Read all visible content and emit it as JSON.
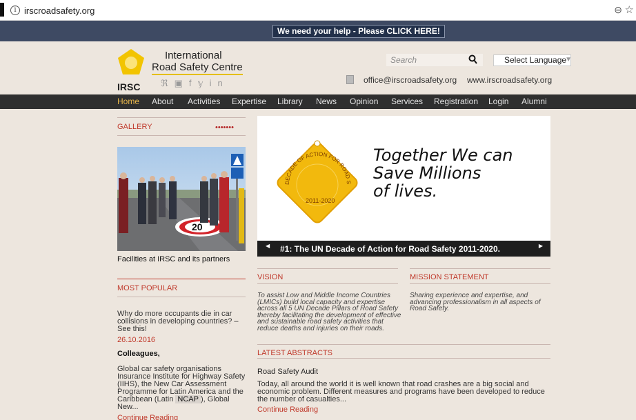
{
  "browser": {
    "url": "irscroadsafety.org",
    "info_glyph": "i",
    "zoom_glyph": "⊖",
    "star_glyph": "☆"
  },
  "help_banner": {
    "label": "We need your help - Please CLICK HERE!"
  },
  "header": {
    "logo_line1": "International",
    "logo_line2": "Road Safety Centre",
    "logo_abbr": "IRSC",
    "social_icons": [
      "rss-icon",
      "youtube-icon",
      "facebook-icon",
      "twitter-icon",
      "linkedin-icon"
    ],
    "social_glyphs": "ℜ▣f𝕪in",
    "search_placeholder": "Search",
    "language_select": "Select Language",
    "email": "office@irscroadsafety.org",
    "website": "www.irscroadsafety.org",
    "accent_color": "#e4bf00"
  },
  "nav": {
    "items": [
      "Home",
      "About",
      "Activities",
      "Expertise",
      "Library",
      "News",
      "Opinion",
      "Services",
      "Registration",
      "Login",
      "Alumni"
    ],
    "active": "Home"
  },
  "gallery": {
    "title": "GALLERY",
    "dots": "•••••••",
    "caption": "Facilities at IRSC and its partners",
    "sign_number": "20"
  },
  "most_popular": {
    "title": "MOST POPULAR",
    "question": "Why do more occupants die in car collisions in developing countries? – See this!",
    "date": "26.10.2016",
    "heading": "Colleagues,",
    "body_before": "Global car safety organisations Insurance Institute for Highway Safety (IIHS), the New Car Assessment Programme for Latin America and the Caribbean (Latin ",
    "ncap": "NCAP",
    "body_after": "), Global New...",
    "continue": "Continue Reading"
  },
  "slider": {
    "badge_text_top": "DECADE OF ACTION FOR ROAD SAFETY",
    "badge_text_bottom": "2011-2020",
    "slogan_line1": "Together We can",
    "slogan_line2": "Save Millions",
    "slogan_line3": "of lives.",
    "caption": "#1: The UN Decade of Action for Road Safety 2011-2020.",
    "prev_glyph": "◀",
    "next_glyph": "▶"
  },
  "vision": {
    "title": "VISION",
    "text": "To assist Low and Middle Income Countries (LMICs) build local capacity and expertise across all 5 UN Decade Pillars of Road Safety thereby facilitating the development of effective and sustainable road safety activities that reduce deaths and injuries on their roads."
  },
  "mission": {
    "title": "MISSION STATEMENT",
    "text": "Sharing experience and expertise, and advancing professionalism in all aspects of Road Safety."
  },
  "abstracts": {
    "title": "LATEST ABSTRACTS",
    "item_title": "Road Safety Audit",
    "item_body": "Today, all around the world it is well known that road crashes are a big social and economic problem. Different measures and programs have been developed to reduce the number of casualties...",
    "continue": "Continue Reading"
  }
}
